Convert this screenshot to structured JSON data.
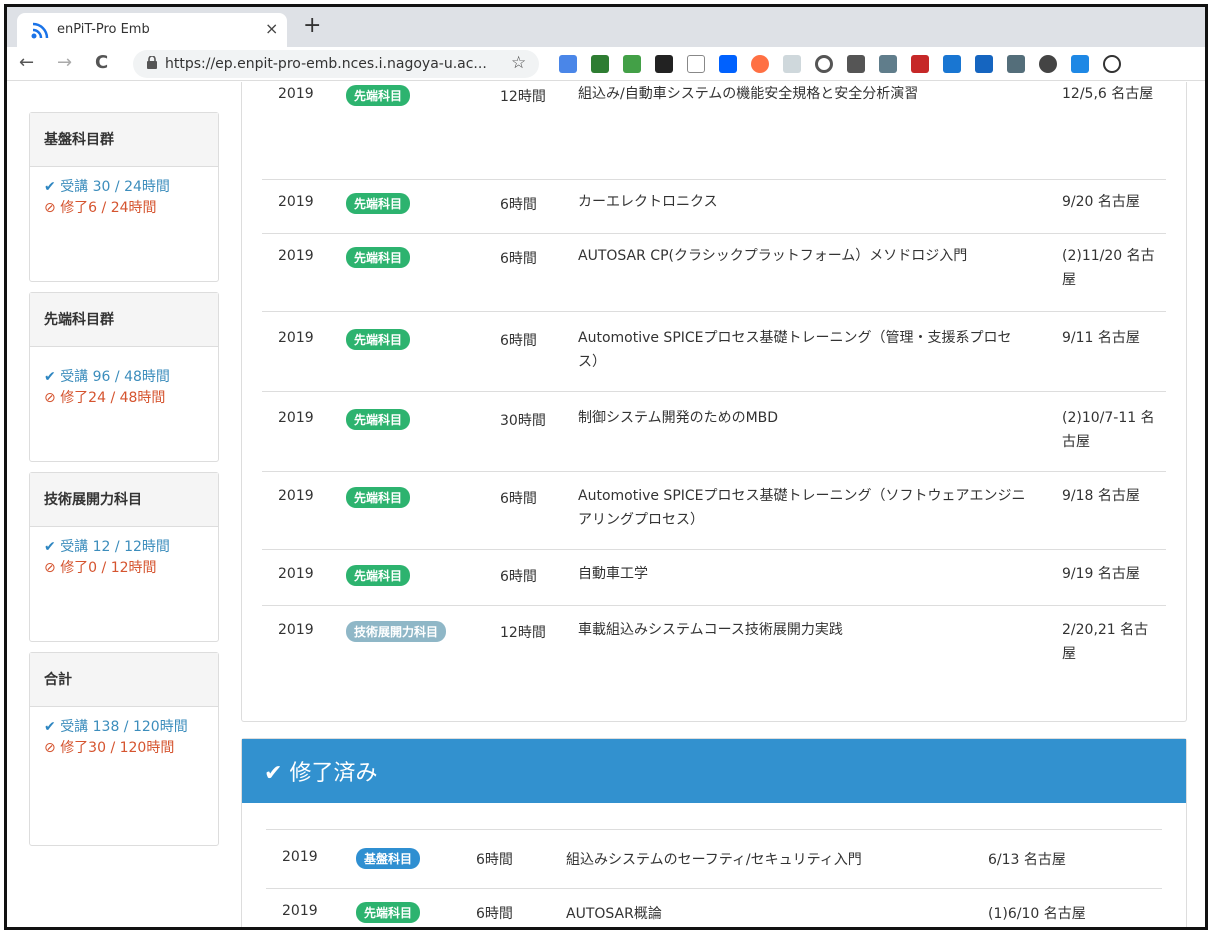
{
  "browser": {
    "tab_title": "enPiT-Pro Emb",
    "close_glyph": "×",
    "newtab_glyph": "+",
    "url": "https://ep.enpit-pro-emb.nces.i.nagoya-u.ac...",
    "back_glyph": "←",
    "forward_glyph": "→",
    "reload_glyph": "C",
    "star_glyph": "☆"
  },
  "sidebar": [
    {
      "heading": "基盤科目群",
      "taken": "受講 30 / 24時間",
      "done": "修了6 / 24時間"
    },
    {
      "heading": "先端科目群",
      "taken": "受講 96 / 48時間",
      "done": "修了24 / 48時間"
    },
    {
      "heading": "技術展開力科目",
      "taken": "受講 12 / 12時間",
      "done": "修了0 / 12時間"
    },
    {
      "heading": "合計",
      "taken": "受講 138 / 120時間",
      "done": "修了30 / 120時間"
    }
  ],
  "courses": [
    {
      "year": "2019",
      "badge": "先端科目",
      "hours": "12時間",
      "title": "組込み/自動車システムの機能安全規格と安全分析演習",
      "date": "12/5,6 名古屋"
    },
    {
      "year": "2019",
      "badge": "先端科目",
      "hours": "6時間",
      "title": "カーエレクトロニクス",
      "date": "9/20 名古屋"
    },
    {
      "year": "2019",
      "badge": "先端科目",
      "hours": "6時間",
      "title": "AUTOSAR CP(クラシックプラットフォーム）メソドロジ入門",
      "date": "(2)11/20 名古屋"
    },
    {
      "year": "2019",
      "badge": "先端科目",
      "hours": "6時間",
      "title": "Automotive SPICEプロセス基礎トレーニング（管理・支援系プロセス）",
      "date": "9/11 名古屋"
    },
    {
      "year": "2019",
      "badge": "先端科目",
      "hours": "30時間",
      "title": "制御システム開発のためのMBD",
      "date": "(2)10/7-11 名古屋"
    },
    {
      "year": "2019",
      "badge": "先端科目",
      "hours": "6時間",
      "title": "Automotive SPICEプロセス基礎トレーニング（ソフトウェアエンジニアリングプロセス）",
      "date": "9/18 名古屋"
    },
    {
      "year": "2019",
      "badge": "先端科目",
      "hours": "6時間",
      "title": "自動車工学",
      "date": "9/19 名古屋"
    },
    {
      "year": "2019",
      "badge": "技術展開力科目",
      "hours": "12時間",
      "title": "車載組込みシステムコース技術展開力実践",
      "date": "2/20,21 名古屋"
    }
  ],
  "completed": {
    "heading": "修了済み",
    "rows": [
      {
        "year": "2019",
        "badge": "基盤科目",
        "hours": "6時間",
        "title": "組込みシステムのセーフティ/セキュリティ入門",
        "date": "6/13 名古屋"
      },
      {
        "year": "2019",
        "badge": "先端科目",
        "hours": "6時間",
        "title": "AUTOSAR概論",
        "date": "(1)6/10 名古屋"
      }
    ]
  },
  "colors": {
    "taken": "#3c8dbc",
    "done": "#d5542f",
    "header_blue": "#3291cf",
    "badge_sentan": "#2db36f",
    "badge_gijutsu": "#8fb7c7",
    "badge_kiban": "#2f8fd1"
  }
}
